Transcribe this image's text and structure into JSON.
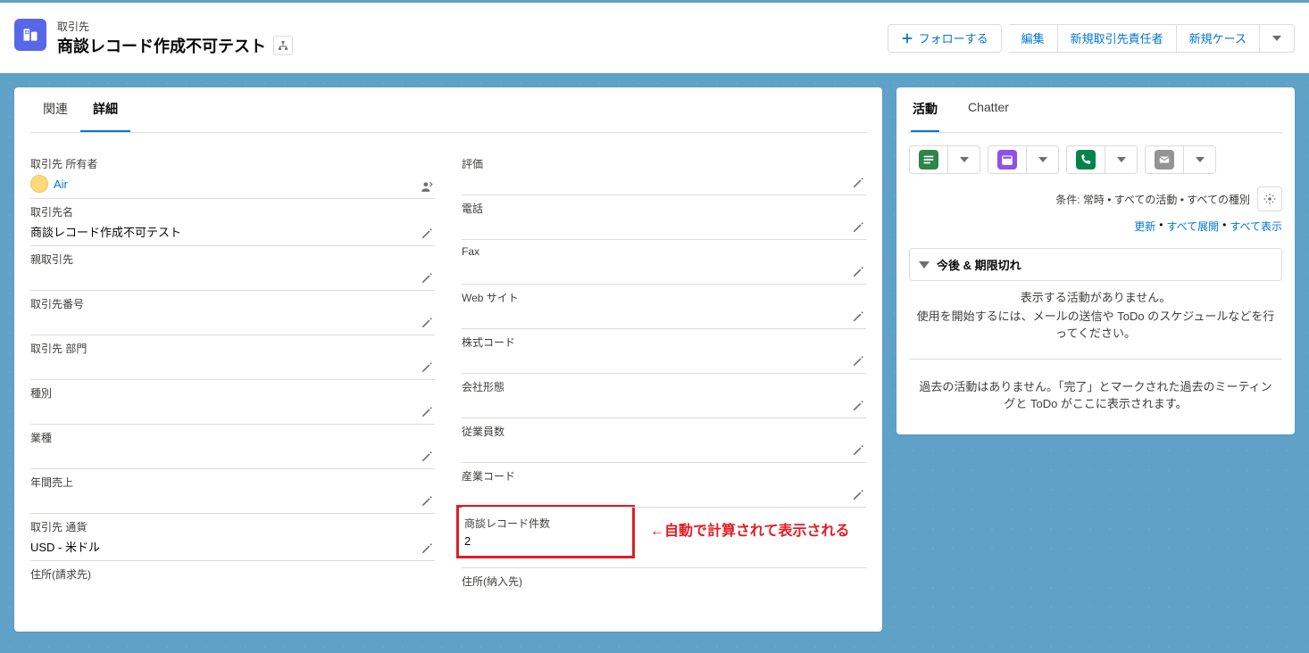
{
  "header": {
    "object_label": "取引先",
    "record_title": "商談レコード作成不可テスト",
    "actions": {
      "follow": "フォローする",
      "edit": "編集",
      "new_contact": "新規取引先責任者",
      "new_case": "新規ケース"
    }
  },
  "tabs": {
    "related": "関連",
    "detail": "詳細"
  },
  "fields": {
    "owner_label": "取引先 所有者",
    "owner_value": "Air",
    "name_label": "取引先名",
    "name_value": "商談レコード作成不可テスト",
    "parent_label": "親取引先",
    "number_label": "取引先番号",
    "dept_label": "取引先 部門",
    "type_label": "種別",
    "industry_label": "業種",
    "revenue_label": "年間売上",
    "currency_label": "取引先 通貨",
    "currency_value": "USD - 米ドル",
    "billing_addr_label": "住所(請求先)",
    "rating_label": "評価",
    "phone_label": "電話",
    "fax_label": "Fax",
    "website_label": "Web サイト",
    "stock_label": "株式コード",
    "company_form_label": "会社形態",
    "employees_label": "従業員数",
    "sic_label": "産業コード",
    "opp_count_label": "商談レコード件数",
    "opp_count_value": "2",
    "shipping_addr_label": "住所(納入先)"
  },
  "annotation": "←自動で計算されて表示される",
  "side": {
    "tabs": {
      "activity": "活動",
      "chatter": "Chatter"
    },
    "filter_line": "条件: 常時 • すべての活動 • すべての種別",
    "links": {
      "refresh": "更新",
      "expand_all": "すべて展開",
      "show_all": "すべて表示"
    },
    "accordion_title": "今後 & 期限切れ",
    "empty_1": "表示する活動がありません。",
    "empty_2": "使用を開始するには、メールの送信や ToDo のスケジュールなどを行ってください。",
    "past_msg": "過去の活動はありません。「完了」とマークされた過去のミーティングと ToDo がここに表示されます。"
  }
}
